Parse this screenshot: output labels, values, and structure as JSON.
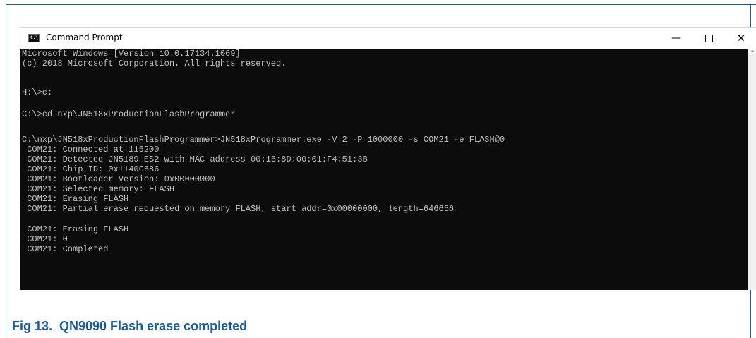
{
  "window": {
    "title": "Command Prompt",
    "icon": "cmd-icon",
    "icon_text": "C:\\",
    "minimize_label": "—",
    "close_label": "✕"
  },
  "console_lines": [
    "Microsoft Windows [Version 10.0.17134.1069]",
    "(c) 2018 Microsoft Corporation. All rights reserved.",
    "",
    "H:\\>c:",
    "",
    "C:\\>cd nxp\\JN518xProductionFlashProgrammer",
    "",
    "C:\\nxp\\JN518xProductionFlashProgrammer>JN518xProgrammer.exe -V 2 -P 1000000 -s COM21 -e FLASH@0",
    " COM21: Connected at 115200",
    " COM21: Detected JN5189 ES2 with MAC address 00:15:8D:00:01:F4:51:3B",
    " COM21: Chip ID: 0x1140C686",
    " COM21: Bootloader Version: 0x00000000",
    " COM21: Selected memory: FLASH",
    " COM21: Erasing FLASH",
    " COM21: Partial erase requested on memory FLASH, start addr=0x00000000, length=646656",
    "",
    " COM21: Erasing FLASH",
    " COM21: 0",
    " COM21: Completed"
  ],
  "scroll_up_glyph": "^",
  "caption": "Fig 13.  QN9090 Flash erase completed",
  "colors": {
    "frame": "#1f5b8f",
    "console_bg": "#0c0c0c",
    "console_text": "#c0c0c0",
    "caption": "#1f5b8f"
  }
}
